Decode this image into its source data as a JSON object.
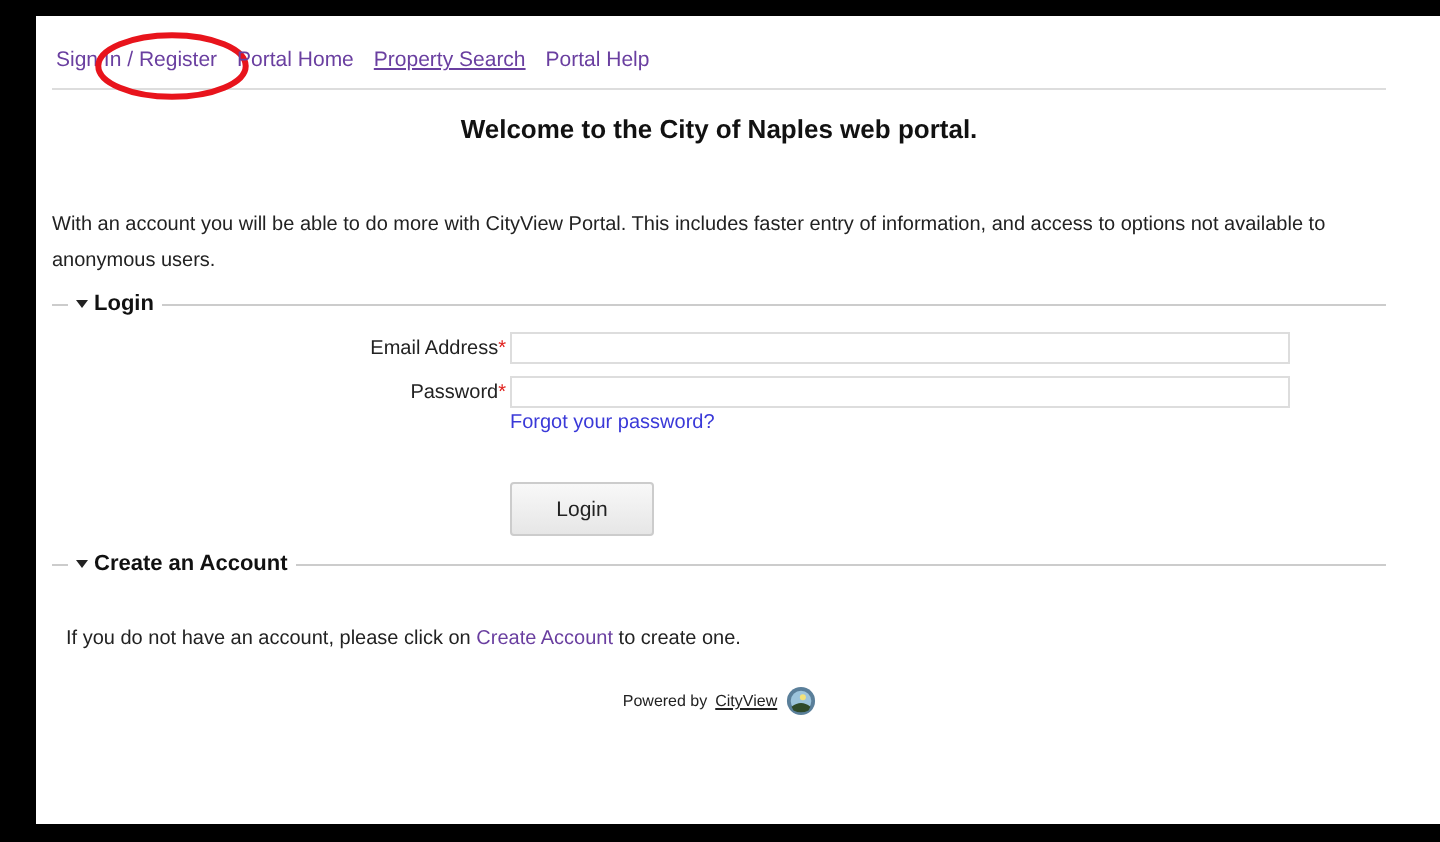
{
  "nav": {
    "links": [
      {
        "label": "Sign In / Register",
        "underlined": false,
        "circled": true
      },
      {
        "label": "Portal Home",
        "underlined": false,
        "circled": false
      },
      {
        "label": "Property Search",
        "underlined": true,
        "circled": false
      },
      {
        "label": "Portal Help",
        "underlined": false,
        "circled": false
      }
    ]
  },
  "heading": "Welcome to the City of Naples web portal.",
  "intro": "With an account you will be able to do more with CityView Portal. This includes faster entry of information, and access to options not available to anonymous users.",
  "login": {
    "title": "Login",
    "expanded": true,
    "fields": [
      {
        "label": "Email Address",
        "required_mark": "*"
      },
      {
        "label": "Password",
        "required_mark": "*"
      }
    ],
    "forgot_link": "Forgot your password?",
    "button": "Login"
  },
  "create_account": {
    "title": "Create an Account",
    "expanded": true,
    "text_before": "If you do not have an account, please click on",
    "link": "Create Account",
    "text_after": "to create one."
  },
  "footer": {
    "powered_by": "Powered by",
    "link": "CityView"
  }
}
